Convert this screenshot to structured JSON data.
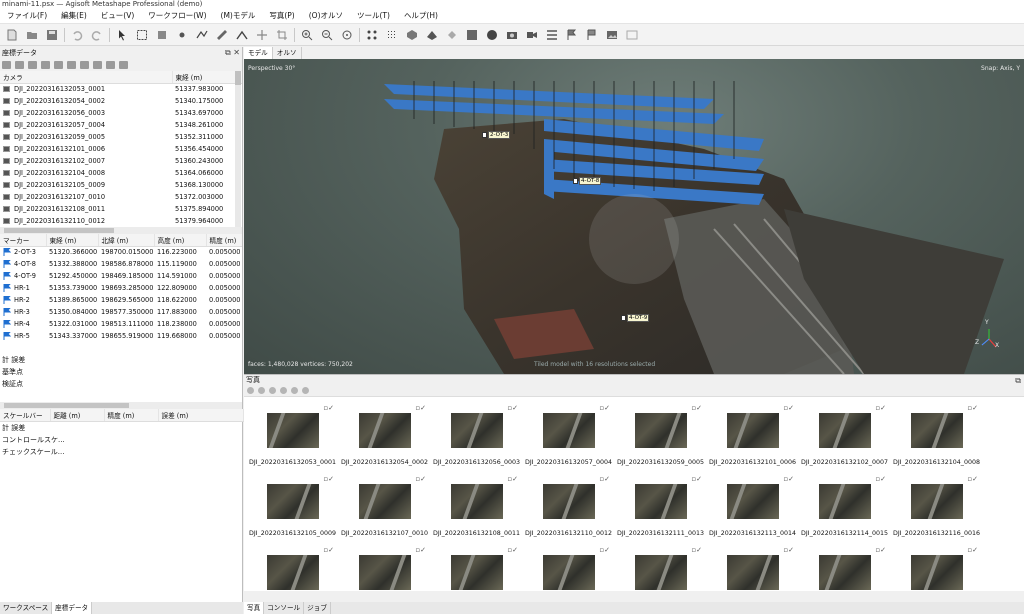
{
  "window": {
    "title": "minami-11.psx — Agisoft Metashape Professional (demo)"
  },
  "menu": [
    "ファイル(F)",
    "編集(E)",
    "ビュー(V)",
    "ワークフロー(W)",
    "(M)モデル",
    "写真(P)",
    "(O)オルソ",
    "ツール(T)",
    "ヘルプ(H)"
  ],
  "reference_panel": {
    "title": "座標データ",
    "camera_columns": [
      "カメラ",
      "東経 (m)"
    ],
    "cameras": [
      {
        "name": "DJI_20220316132053_0001",
        "east": "51337.983000"
      },
      {
        "name": "DJI_20220316132054_0002",
        "east": "51340.175000"
      },
      {
        "name": "DJI_20220316132056_0003",
        "east": "51343.697000"
      },
      {
        "name": "DJI_20220316132057_0004",
        "east": "51348.261000"
      },
      {
        "name": "DJI_20220316132059_0005",
        "east": "51352.311000"
      },
      {
        "name": "DJI_20220316132101_0006",
        "east": "51356.454000"
      },
      {
        "name": "DJI_20220316132102_0007",
        "east": "51360.243000"
      },
      {
        "name": "DJI_20220316132104_0008",
        "east": "51364.066000"
      },
      {
        "name": "DJI_20220316132105_0009",
        "east": "51368.130000"
      },
      {
        "name": "DJI_20220316132107_0010",
        "east": "51372.003000"
      },
      {
        "name": "DJI_20220316132108_0011",
        "east": "51375.894000"
      },
      {
        "name": "DJI_20220316132110_0012",
        "east": "51379.964000"
      }
    ],
    "marker_columns": [
      "マーカー",
      "東経 (m)",
      "北緯 (m)",
      "高度 (m)",
      "精度 (m)"
    ],
    "markers": [
      {
        "name": "2-OT-3",
        "east": "51320.366000",
        "north": "198700.015000",
        "alt": "116.223000",
        "acc": "0.005000"
      },
      {
        "name": "4-OT-8",
        "east": "51332.388000",
        "north": "198586.878000",
        "alt": "115.119000",
        "acc": "0.005000"
      },
      {
        "name": "4-OT-9",
        "east": "51292.450000",
        "north": "198469.185000",
        "alt": "114.591000",
        "acc": "0.005000"
      },
      {
        "name": "HR-1",
        "east": "51353.739000",
        "north": "198693.285000",
        "alt": "122.809000",
        "acc": "0.005000"
      },
      {
        "name": "HR-2",
        "east": "51389.865000",
        "north": "198629.565000",
        "alt": "118.622000",
        "acc": "0.005000"
      },
      {
        "name": "HR-3",
        "east": "51350.084000",
        "north": "198577.350000",
        "alt": "117.883000",
        "acc": "0.005000"
      },
      {
        "name": "HR-4",
        "east": "51322.031000",
        "north": "198513.111000",
        "alt": "118.238000",
        "acc": "0.005000"
      },
      {
        "name": "HR-5",
        "east": "51343.337000",
        "north": "198655.919000",
        "alt": "119.668000",
        "acc": "0.005000"
      }
    ],
    "tree1": [
      "計 誤差",
      "基準点",
      "検証点"
    ],
    "scalebar_columns": [
      "スケールバー",
      "距離 (m)",
      "精度 (m)",
      "誤差 (m)"
    ],
    "tree2": [
      "計 誤差",
      "コントロールスケ...",
      "チェックスケール..."
    ]
  },
  "left_tabs": [
    "ワークスペース",
    "座標データ"
  ],
  "viewport": {
    "tabs": [
      "モデル",
      "オルソ"
    ],
    "perspective": "Perspective 30°",
    "snap": "Snap: Axis, Y",
    "stats": "faces: 1,480,028 vertices: 750,202",
    "note": "Tiled model with 16 resolutions selected",
    "markers": [
      "2-OT-3",
      "4-OT-8",
      "4-OT-9"
    ],
    "axes": {
      "x": "X",
      "y": "Y",
      "z": "Z"
    }
  },
  "photos": {
    "title": "写真",
    "items": [
      "DJI_20220316132053_0001",
      "DJI_20220316132054_0002",
      "DJI_20220316132056_0003",
      "DJI_20220316132057_0004",
      "DJI_20220316132059_0005",
      "DJI_20220316132101_0006",
      "DJI_20220316132102_0007",
      "DJI_20220316132104_0008",
      "DJI_20220316132105_0009",
      "DJI_20220316132107_0010",
      "DJI_20220316132108_0011",
      "DJI_20220316132110_0012",
      "DJI_20220316132111_0013",
      "DJI_20220316132113_0014",
      "DJI_20220316132114_0015",
      "DJI_20220316132116_0016",
      "",
      "",
      "",
      "",
      "",
      "",
      "",
      ""
    ]
  },
  "bottom_tabs": [
    "写真",
    "コンソール",
    "ジョブ"
  ],
  "colors": {
    "accent": "#3a78c6",
    "marker_flag": "#1f6fd1"
  }
}
